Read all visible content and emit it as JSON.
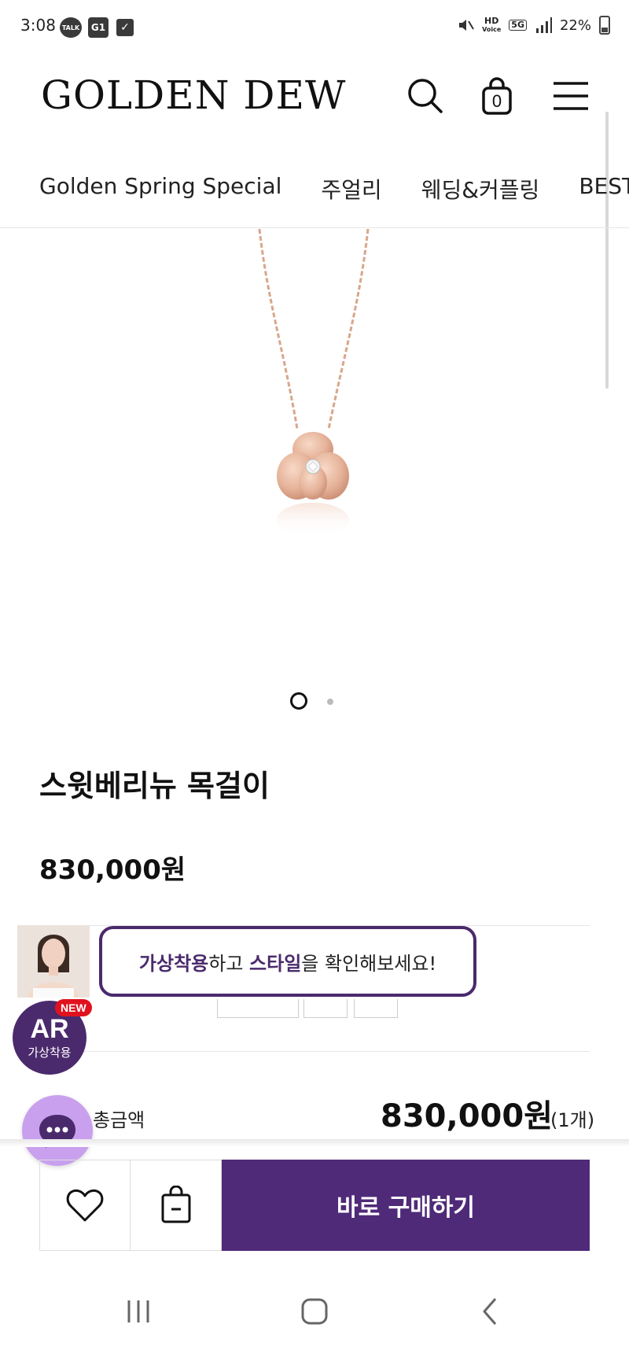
{
  "status_bar": {
    "time": "3:08",
    "talk_label": "TALK",
    "g1_label": "G1",
    "hd_label": "HD",
    "voice_label": "Voice",
    "net_label": "5G",
    "battery": "22%",
    "icons": [
      "talk-icon",
      "g1-icon",
      "check-icon",
      "mute-icon",
      "signal-icon",
      "battery-icon"
    ]
  },
  "header": {
    "logo": "GOLDEN DEW",
    "cart_count": "0"
  },
  "categories": [
    "Golden Spring Special",
    "주얼리",
    "웨딩&커플링",
    "BEST"
  ],
  "gallery": {
    "current_slide": 1,
    "total_slides": 2
  },
  "product": {
    "title": "스윗베리뉴 목걸이",
    "price": "830,000원"
  },
  "ar_popup": {
    "text_a": "가상착용",
    "text_b": "하고 ",
    "text_c": "스타일",
    "text_d": "을 확인해보세요!",
    "badge_ar": "AR",
    "badge_label": "가상착용",
    "new_badge": "NEW"
  },
  "total": {
    "label": "총금액",
    "price": "830,000원",
    "qty": "(1개)"
  },
  "bottom_bar": {
    "buy_label": "바로 구매하기"
  },
  "colors": {
    "brand_purple": "#4f2a78",
    "chat_bubble": "#c9a0ee",
    "new_badge": "#e0121e",
    "rose_gold": "#e6b39a"
  }
}
